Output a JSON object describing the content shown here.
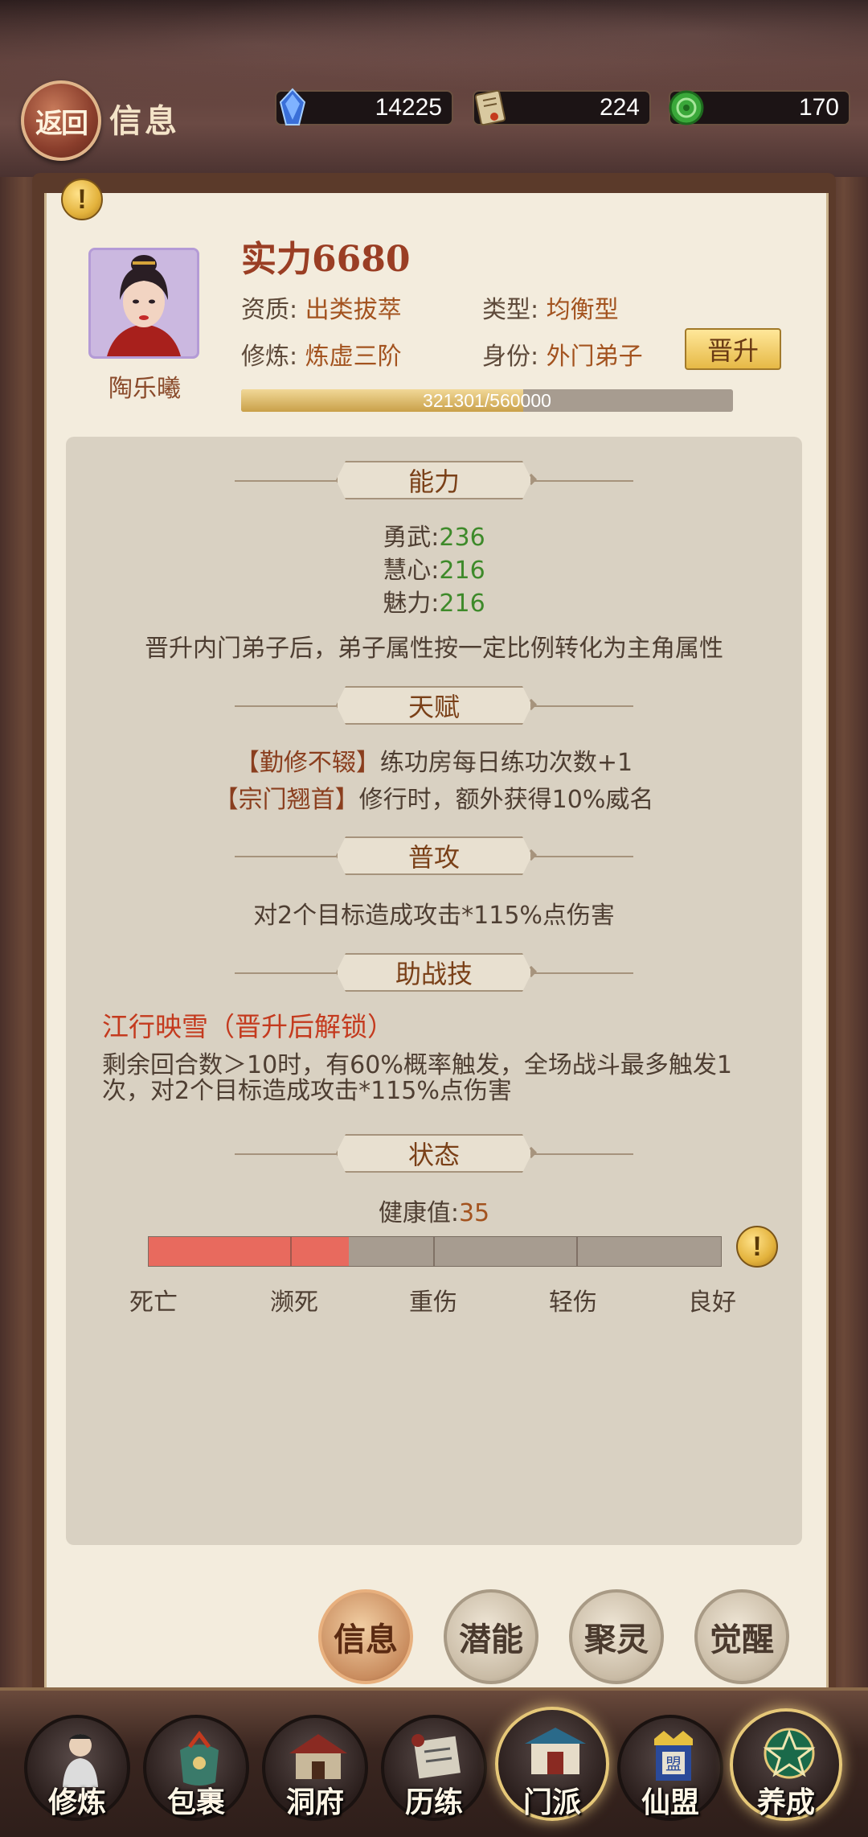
{
  "header": {
    "back_label": "返回",
    "title": "信息"
  },
  "resources": [
    {
      "icon": "crystal-icon",
      "value": "14225"
    },
    {
      "icon": "scroll-token-icon",
      "value": "224"
    },
    {
      "icon": "jade-coin-icon",
      "value": "170"
    }
  ],
  "character": {
    "name": "陶乐曦",
    "power_label": "实力",
    "power_value": "6680",
    "aptitude_label": "资质:",
    "aptitude_value": "出类拔萃",
    "type_label": "类型:",
    "type_value": "均衡型",
    "cultivation_label": "修炼:",
    "cultivation_value": "炼虚三阶",
    "identity_label": "身份:",
    "identity_value": "外门弟子",
    "promote_label": "晋升",
    "exp_text": "321301/560000",
    "exp_fraction": 0.5737
  },
  "sections": {
    "ability": {
      "title": "能力",
      "stats": [
        {
          "label": "勇武:",
          "value": "236"
        },
        {
          "label": "慧心:",
          "value": "216"
        },
        {
          "label": "魅力:",
          "value": "216"
        }
      ],
      "note": "晋升内门弟子后，弟子属性按一定比例转化为主角属性"
    },
    "talent": {
      "title": "天赋",
      "items": [
        {
          "name": "【勤修不辍】",
          "desc": "练功房每日练功次数+1"
        },
        {
          "name": "【宗门翘首】",
          "desc": "修行时，额外获得10%威名"
        }
      ]
    },
    "attack": {
      "title": "普攻",
      "desc": "对2个目标造成攻击*115%点伤害"
    },
    "assist": {
      "title": "助战技",
      "skill_name": "江行映雪（晋升后解锁）",
      "desc": "剩余回合数＞10时，有60%概率触发，全场战斗最多触发1次，对2个目标造成攻击*115%点伤害"
    },
    "status": {
      "title": "状态",
      "health_label": "健康值:",
      "health_value": "35",
      "health_fraction": 0.35,
      "levels": [
        "死亡",
        "濒死",
        "重伤",
        "轻伤",
        "良好"
      ]
    }
  },
  "tabs": [
    {
      "label": "信息",
      "active": true
    },
    {
      "label": "潜能",
      "active": false
    },
    {
      "label": "聚灵",
      "active": false
    },
    {
      "label": "觉醒",
      "active": false
    }
  ],
  "nav": [
    {
      "label": "修炼"
    },
    {
      "label": "包裹"
    },
    {
      "label": "洞府"
    },
    {
      "label": "历练"
    },
    {
      "label": "门派"
    },
    {
      "label": "仙盟"
    },
    {
      "label": "养成"
    }
  ],
  "colors": {
    "accent_brown": "#9a3e24",
    "stat_green": "#3e8a2a",
    "locked_red": "#c43a1e",
    "health_red": "#e86a5e",
    "button_gold": "#e6b946"
  }
}
